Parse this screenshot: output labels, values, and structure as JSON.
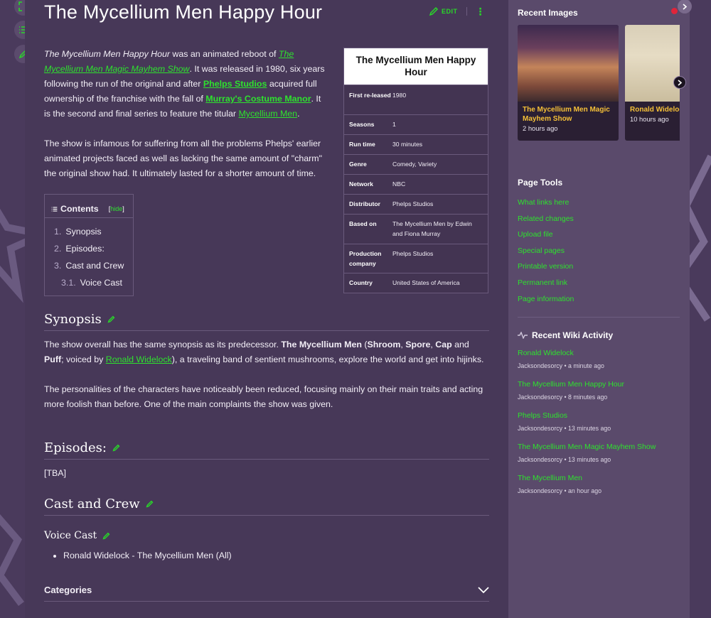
{
  "page": {
    "title": "The Mycellium Men Happy Hour",
    "edit_label": "EDIT",
    "more_label": "⋮"
  },
  "intro": {
    "p1_title_italic": "The Mycellium Men Happy Hour",
    "p1_t1": " was an animated reboot of ",
    "p1_link1": "The Mycellium Men Magic Mayhem Show",
    "p1_t2": ". It was released in 1980, six years following the run of the original and after ",
    "p1_link2": "Phelps Studios",
    "p1_t3": " acquired full ownership of the franchise with the fall of ",
    "p1_link3": "Murray's Costume Manor",
    "p1_t4": ". It is the second and final series to feature the titular ",
    "p1_link4": "Mycellium Men",
    "p1_t5": ".",
    "p2": "The show is infamous for suffering from all the problems Phelps' earlier animated projects faced as well as lacking the same amount of \"charm\" the original show had. It ultimately lasted for a shorter amount of time."
  },
  "infobox": {
    "title": "The Mycellium Men Happy Hour",
    "rows": [
      {
        "label": "First re-leased",
        "value": "1980"
      },
      {
        "label": "Seasons",
        "value": "1"
      },
      {
        "label": "Run time",
        "value": "30 minutes"
      },
      {
        "label": "Genre",
        "value": "Comedy, Variety"
      },
      {
        "label": "Network",
        "value": "NBC"
      },
      {
        "label": "Distributor",
        "value": "Phelps Studios"
      },
      {
        "label": "Based on",
        "value": "The Mycellium Men by Edwin and Fiona Murray"
      },
      {
        "label": "Production company",
        "value": "Phelps Studios"
      },
      {
        "label": "Country",
        "value": "United States of America"
      }
    ]
  },
  "toc": {
    "label": "Contents",
    "hide_open": "[",
    "hide_label": "hide",
    "hide_close": "]",
    "items": [
      {
        "num": "1.",
        "text": "Synopsis"
      },
      {
        "num": "2.",
        "text": "Episodes:"
      },
      {
        "num": "3.",
        "text": "Cast and Crew"
      },
      {
        "num": "3.1.",
        "text": "Voice Cast"
      }
    ]
  },
  "synopsis": {
    "heading": "Synopsis",
    "p1_t1": "The show overall has the same synopsis as its predecessor. ",
    "p1_b1": "The Mycellium Men",
    "p1_t2": " (",
    "p1_b2": "Shroom",
    "p1_t3": ", ",
    "p1_b3": "Spore",
    "p1_t4": ", ",
    "p1_b4": "Cap",
    "p1_t5": " and ",
    "p1_b5": "Puff",
    "p1_t6": "; voiced by ",
    "p1_link": "Ronald Widelock",
    "p1_t7": "), a traveling band of sentient mushrooms, explore the world and get into hijinks.",
    "p2": "The personalities of the characters have noticeably been reduced, focusing mainly on their main traits and acting more foolish than before. One of the main complaints the show was given."
  },
  "episodes": {
    "heading": "Episodes:",
    "body": "[TBA]"
  },
  "cast": {
    "heading": "Cast and Crew",
    "sub_heading": "Voice Cast",
    "items": [
      "Ronald Widelock - The Mycellium Men (All)"
    ]
  },
  "categories": {
    "label": "Categories"
  },
  "sidebar": {
    "recent_images": "Recent Images",
    "images": [
      {
        "title": "The Mycellium Men Magic Mayhem Show",
        "time": "2 hours ago"
      },
      {
        "title": "Ronald Widelock",
        "time": "10 hours ago"
      }
    ],
    "page_tools": "Page Tools",
    "tools": [
      "What links here",
      "Related changes",
      "Upload file",
      "Special pages",
      "Printable version",
      "Permanent link",
      "Page information"
    ],
    "activity_heading": "Recent Wiki Activity",
    "activity": [
      {
        "title": "Ronald Widelock",
        "meta": "Jacksondesorcy • a minute ago"
      },
      {
        "title": "The Mycellium Men Happy Hour",
        "meta": "Jacksondesorcy • 8 minutes ago"
      },
      {
        "title": "Phelps Studios",
        "meta": "Jacksondesorcy • 13 minutes ago"
      },
      {
        "title": "The Mycellium Men Magic Mayhem Show",
        "meta": "Jacksondesorcy • 13 minutes ago"
      },
      {
        "title": "The Mycellium Men",
        "meta": "Jacksondesorcy • an hour ago"
      }
    ]
  },
  "colors": {
    "accent": "#2ee22e",
    "background": "#4a3a5c",
    "caption_title": "#f5c038"
  }
}
